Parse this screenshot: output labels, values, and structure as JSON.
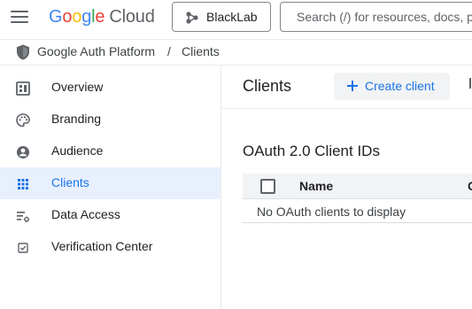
{
  "header": {
    "logo_google": "Google",
    "logo_cloud": "Cloud",
    "project": "BlackLab",
    "search_placeholder": "Search (/) for resources, docs, products, and more",
    "colors": {
      "blue": "#4285F4",
      "red": "#EA4335",
      "yellow": "#FBBC05",
      "green": "#34A853"
    }
  },
  "breadcrumb": {
    "icon": "shield-icon",
    "items": [
      "Google Auth Platform",
      "/",
      "Clients"
    ]
  },
  "sidebar": {
    "items": [
      {
        "label": "Overview",
        "icon": "dashboard-icon",
        "active": false
      },
      {
        "label": "Branding",
        "icon": "palette-icon",
        "active": false
      },
      {
        "label": "Audience",
        "icon": "person-icon",
        "active": false
      },
      {
        "label": "Clients",
        "icon": "apps-grid-icon",
        "active": true
      },
      {
        "label": "Data Access",
        "icon": "data-access-icon",
        "active": false
      },
      {
        "label": "Verification Center",
        "icon": "verified-checkbox-icon",
        "active": false
      }
    ]
  },
  "main": {
    "title": "Clients",
    "create_button": "Create client",
    "section_title": "OAuth 2.0 Client IDs",
    "columns": [
      "Name",
      "C"
    ],
    "empty_message": "No OAuth clients to display"
  },
  "accent_color": "#1a73e8",
  "active_bg": "#e8f0fe"
}
